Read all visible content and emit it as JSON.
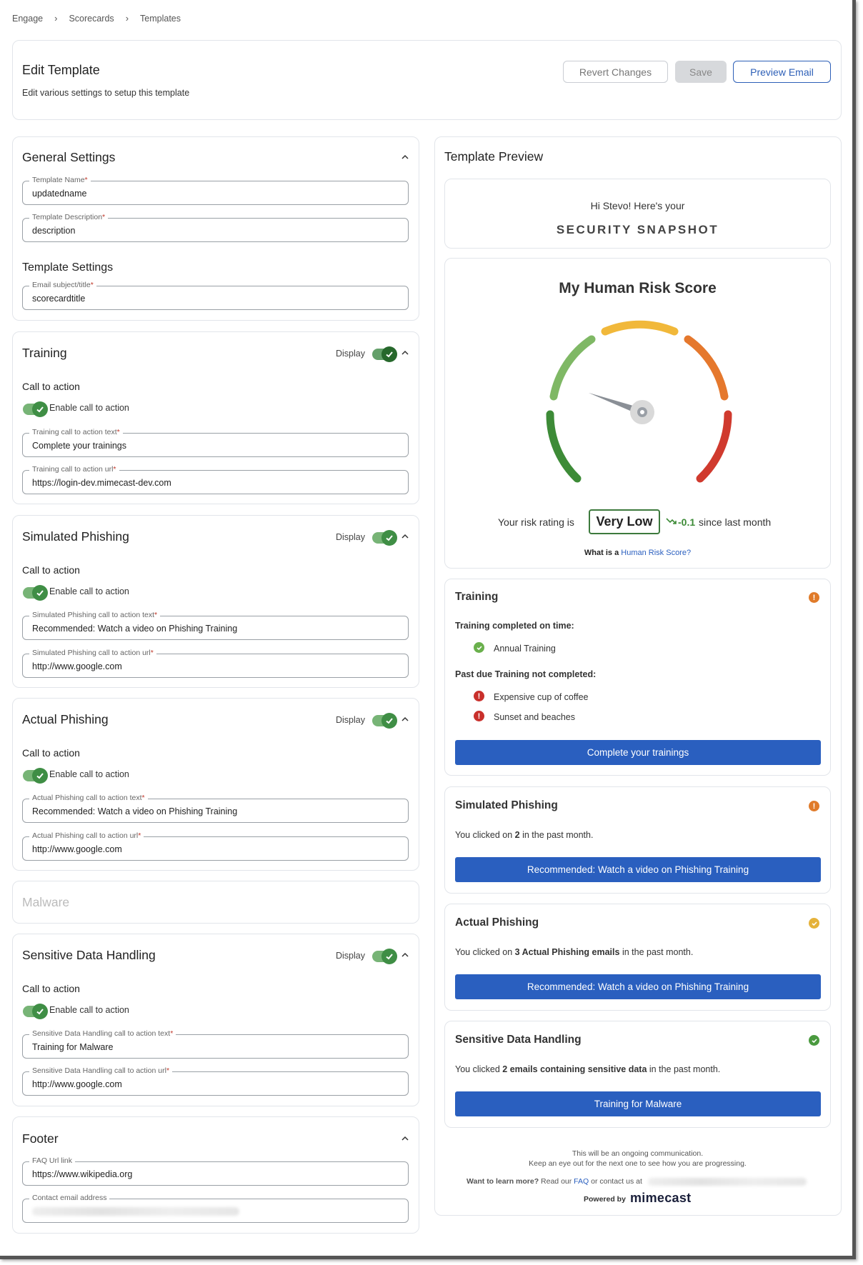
{
  "breadcrumb": [
    "Engage",
    "Scorecards",
    "Templates"
  ],
  "header": {
    "title": "Edit Template",
    "subtitle": "Edit various settings to setup this template",
    "revert_label": "Revert Changes",
    "save_label": "Save",
    "preview_label": "Preview Email"
  },
  "general": {
    "title": "General Settings",
    "name_label": "Template Name",
    "name_value": "updatedname",
    "desc_label": "Template Description",
    "desc_value": "description",
    "template_settings_title": "Template Settings",
    "subject_label": "Email subject/title",
    "subject_value": "scorecardtitle"
  },
  "common": {
    "display_label": "Display",
    "cta_title": "Call to action",
    "enable_cta": "Enable call to action",
    "required_mark": "*"
  },
  "sections": {
    "training": {
      "title": "Training",
      "text_label": "Training call to action text",
      "text_value": "Complete your trainings",
      "url_label": "Training call to action url",
      "url_value": "https://login-dev.mimecast-dev.com"
    },
    "simulated": {
      "title": "Simulated Phishing",
      "text_label": "Simulated Phishing call to action text",
      "text_value": "Recommended: Watch a video on Phishing Training",
      "url_label": "Simulated Phishing call to action url",
      "url_value": "http://www.google.com"
    },
    "actual": {
      "title": "Actual Phishing",
      "text_label": "Actual Phishing call to action text",
      "text_value": "Recommended: Watch a video on Phishing Training",
      "url_label": "Actual Phishing call to action url",
      "url_value": "http://www.google.com"
    },
    "malware": {
      "title": "Malware"
    },
    "sensitive": {
      "title": "Sensitive Data Handling",
      "text_label": "Sensitive Data Handling call to action text",
      "text_value": "Training for Malware",
      "url_label": "Sensitive Data Handling call to action url",
      "url_value": "http://www.google.com"
    },
    "footer": {
      "title": "Footer",
      "faq_label": "FAQ Url link",
      "faq_value": "https://www.wikipedia.org",
      "contact_label": "Contact email address"
    }
  },
  "preview": {
    "title": "Template Preview",
    "greeting": "Hi Stevo! Here's your",
    "snapshot": "SECURITY SNAPSHOT",
    "risk_title": "My Human Risk Score",
    "gauge_value": 0.24,
    "rating_prefix": "Your risk rating is",
    "rating": "Very Low",
    "delta": "-0.1",
    "delta_suffix": "since last month",
    "what_is": "What is a",
    "what_is_link": "Human Risk Score?",
    "training": {
      "title": "Training",
      "completed_heading": "Training completed on time:",
      "completed": [
        "Annual Training"
      ],
      "pastdue_heading": "Past due Training not completed:",
      "pastdue": [
        "Expensive cup of coffee",
        "Sunset and beaches"
      ],
      "button": "Complete your trainings"
    },
    "simulated": {
      "title": "Simulated Phishing",
      "text_a": "You clicked on",
      "count": "2",
      "text_b": "in the past month.",
      "button": "Recommended: Watch a video on Phishing Training"
    },
    "actual": {
      "title": "Actual Phishing",
      "text_a": "You clicked on",
      "bold": "3 Actual Phishing emails",
      "text_b": "in the past month.",
      "button": "Recommended: Watch a video on Phishing Training"
    },
    "sensitive": {
      "title": "Sensitive Data Handling",
      "text_a": "You clicked",
      "bold": "2 emails containing sensitive data",
      "text_b": "in the past month.",
      "button": "Training for Malware"
    },
    "footer": {
      "line1": "This will be an ongoing communication.",
      "line2": "Keep an eye out for the next one to see how you are progressing.",
      "learn_bold": "Want to learn more?",
      "learn_a": "Read our",
      "faq": "FAQ",
      "learn_b": "or contact us at",
      "powered_by": "Powered by",
      "brand": "mimecast"
    }
  },
  "colors": {
    "primary": "#2a5fbf",
    "toggle_on": "#3f8e45",
    "orange_alert": "#e07b2a",
    "red_alert": "#c9302c",
    "yellow_ok": "#e5b23a",
    "green_ok": "#4a9a3f"
  }
}
